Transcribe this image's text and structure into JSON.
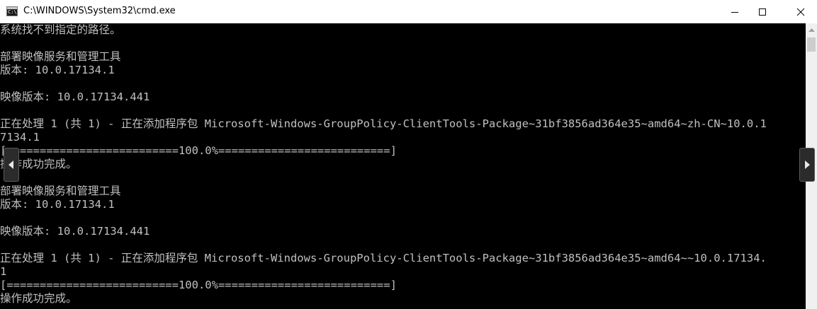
{
  "window": {
    "title": "C:\\WINDOWS\\System32\\cmd.exe",
    "icon_text": "C:\\."
  },
  "console": {
    "lines": [
      "系统找不到指定的路径。",
      "",
      "部署映像服务和管理工具",
      "版本: 10.0.17134.1",
      "",
      "映像版本: 10.0.17134.441",
      "",
      "正在处理 1 (共 1) - 正在添加程序包 Microsoft-Windows-GroupPolicy-ClientTools-Package~31bf3856ad364e35~amd64~zh-CN~10.0.1",
      "7134.1",
      "[==========================100.0%==========================]",
      "操作成功完成。",
      "",
      "部署映像服务和管理工具",
      "版本: 10.0.17134.1",
      "",
      "映像版本: 10.0.17134.441",
      "",
      "正在处理 1 (共 1) - 正在添加程序包 Microsoft-Windows-GroupPolicy-ClientTools-Package~31bf3856ad364e35~amd64~~10.0.17134.",
      "1",
      "[==========================100.0%==========================]",
      "操作成功完成。"
    ]
  },
  "icons": {
    "app": "console-icon",
    "minimize": "minimize-icon",
    "maximize": "maximize-icon",
    "close": "close-icon",
    "scroll_up": "scroll-up-arrow-icon",
    "prev": "chevron-left-icon",
    "next": "chevron-right-icon"
  },
  "colors": {
    "console_bg": "#000000",
    "console_text": "#c0c0c0",
    "titlebar_bg": "#ffffff",
    "scrollbar_bg": "#f0f0f0"
  }
}
